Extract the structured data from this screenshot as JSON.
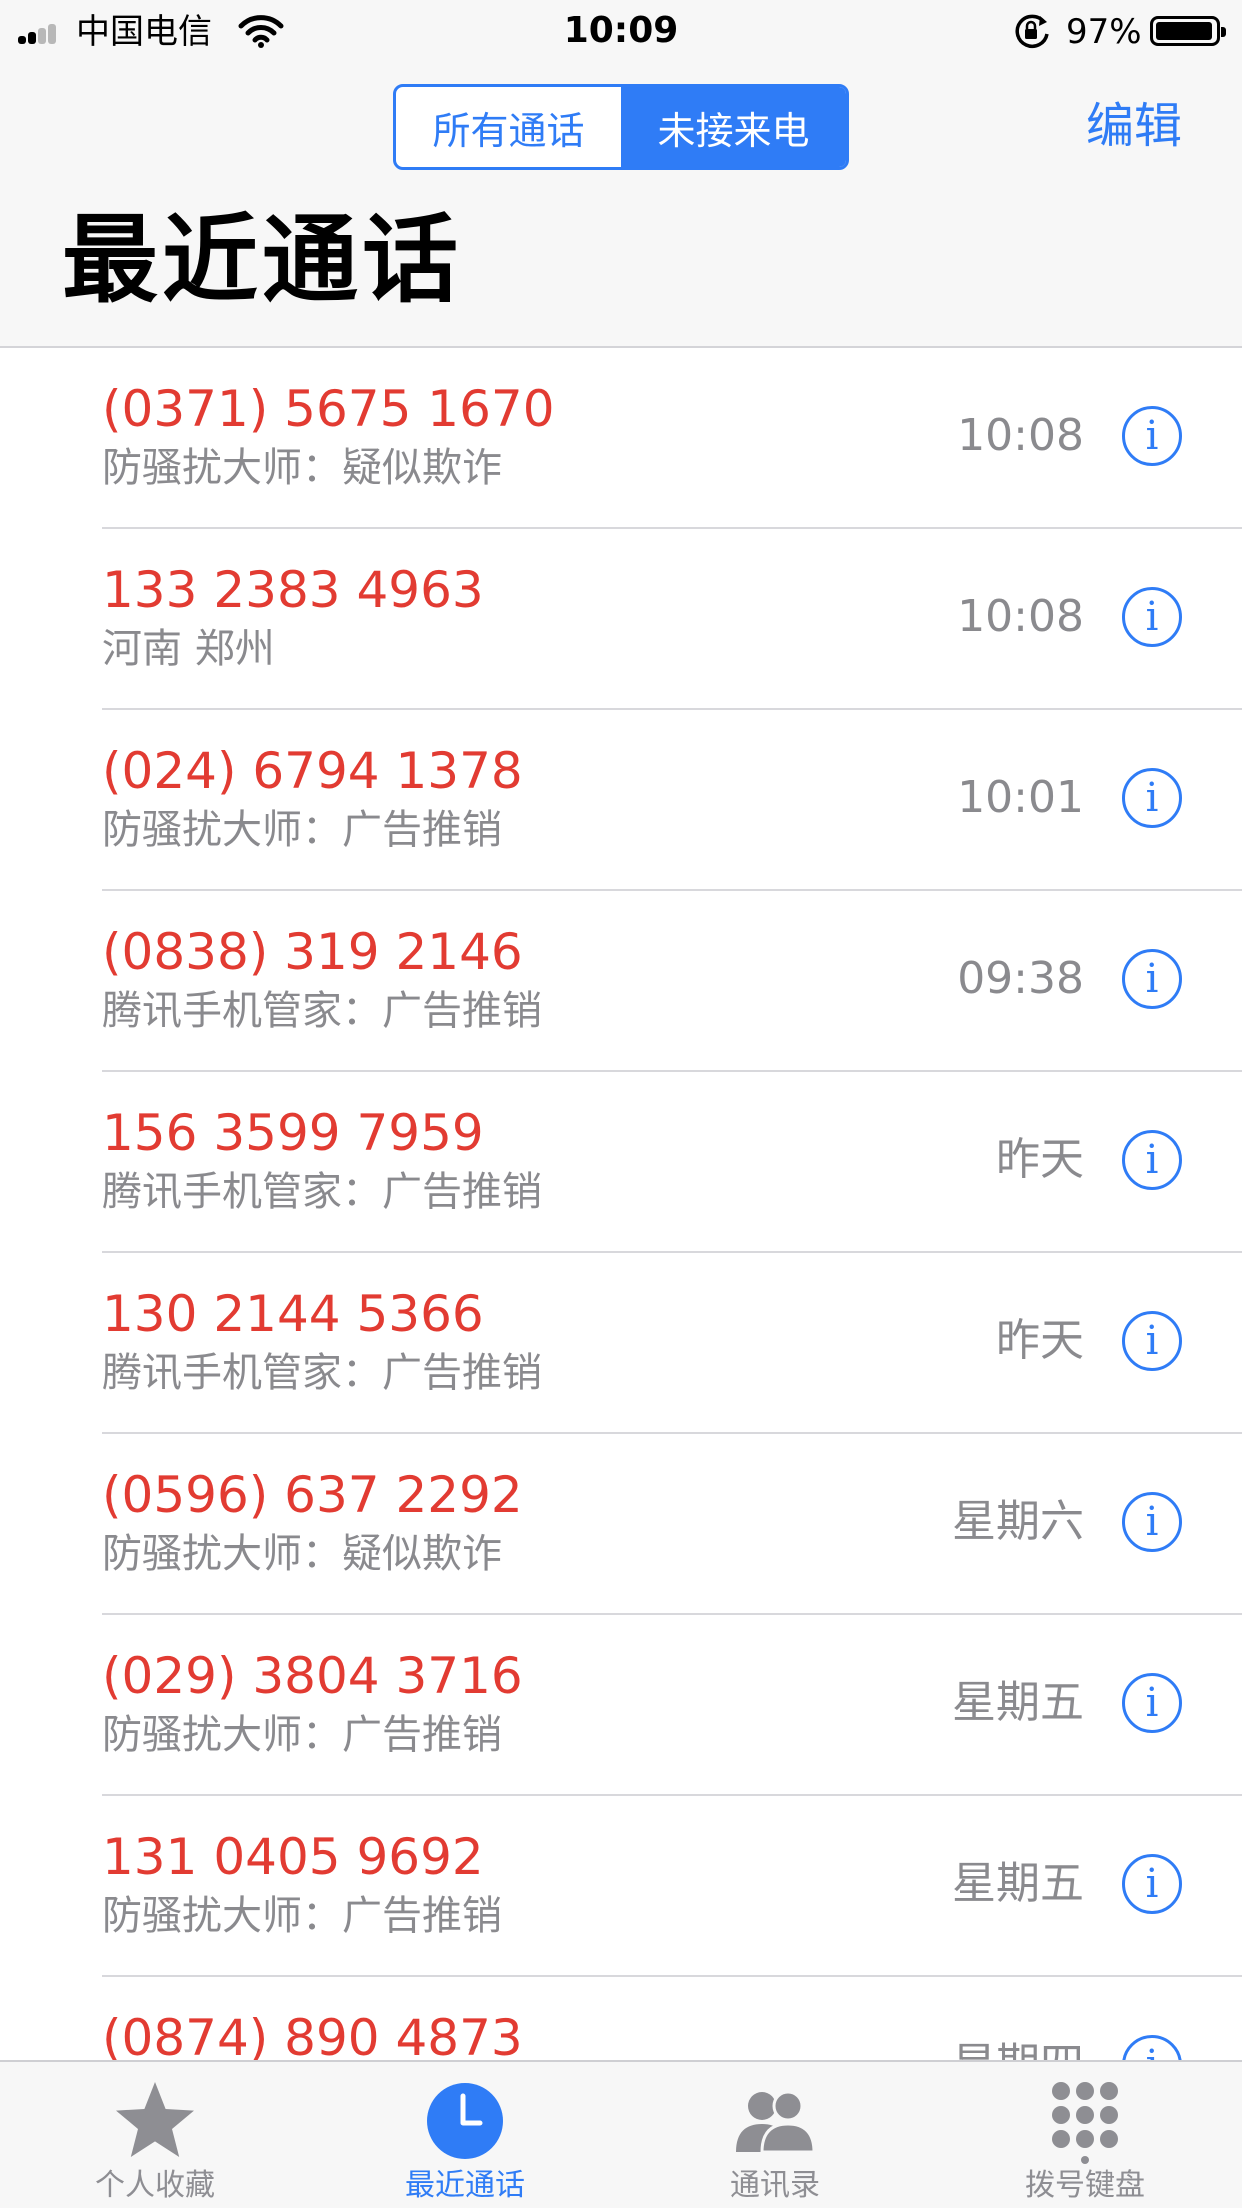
{
  "status_bar": {
    "carrier": "中国电信",
    "time": "10:09",
    "battery_percent": "97%",
    "battery_level": 0.97,
    "icons": [
      "cellular-signal-icon",
      "wifi-icon",
      "rotation-lock-icon",
      "battery-icon"
    ]
  },
  "header": {
    "segments": [
      {
        "label": "所有通话",
        "selected": false
      },
      {
        "label": "未接来电",
        "selected": true
      }
    ],
    "edit_label": "编辑",
    "title": "最近通话"
  },
  "calls": [
    {
      "number": "(0371) 5675 1670",
      "detail": "防骚扰大师：疑似欺诈",
      "time": "10:08"
    },
    {
      "number": "133 2383 4963",
      "detail": "河南 郑州",
      "time": "10:08"
    },
    {
      "number": "(024) 6794 1378",
      "detail": "防骚扰大师：广告推销",
      "time": "10:01"
    },
    {
      "number": "(0838) 319 2146",
      "detail": "腾讯手机管家：广告推销",
      "time": "09:38"
    },
    {
      "number": "156 3599 7959",
      "detail": "腾讯手机管家：广告推销",
      "time": "昨天"
    },
    {
      "number": "130 2144 5366",
      "detail": "腾讯手机管家：广告推销",
      "time": "昨天"
    },
    {
      "number": "(0596) 637 2292",
      "detail": "防骚扰大师：疑似欺诈",
      "time": "星期六"
    },
    {
      "number": "(029) 3804 3716",
      "detail": "防骚扰大师：广告推销",
      "time": "星期五"
    },
    {
      "number": "131 0405 9692",
      "detail": "防骚扰大师：广告推销",
      "time": "星期五"
    },
    {
      "number": "(0874) 890 4873",
      "detail": "",
      "time": "星期四"
    }
  ],
  "info_glyph": "i",
  "tab_bar": {
    "tabs": [
      {
        "label": "个人收藏",
        "icon": "star-icon",
        "active": false
      },
      {
        "label": "最近通话",
        "icon": "clock-icon",
        "active": true
      },
      {
        "label": "通讯录",
        "icon": "contacts-icon",
        "active": false
      },
      {
        "label": "拨号键盘",
        "icon": "keypad-icon",
        "active": false
      }
    ]
  },
  "colors": {
    "accent": "#2f7cf6",
    "missed_call": "#e23b32",
    "secondary_text": "#8a8a8e",
    "bar_background": "#f7f7f7"
  }
}
